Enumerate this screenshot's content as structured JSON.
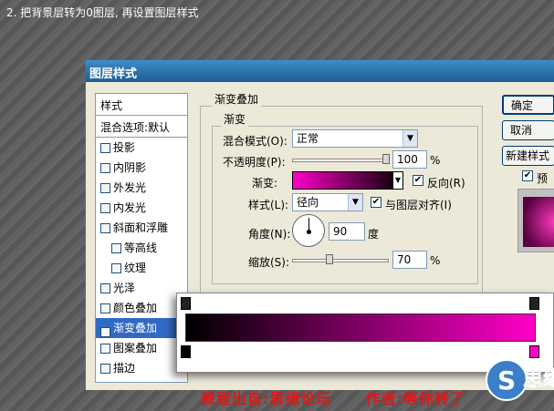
{
  "caption": "2. 把背景层转为0图层, 再设置图层样式",
  "dialog": {
    "title": "图层样式",
    "left_panel": {
      "header": "样式",
      "blend_default": "混合选项:默认",
      "items": [
        {
          "label": "投影",
          "checked": false
        },
        {
          "label": "内阴影",
          "checked": false
        },
        {
          "label": "外发光",
          "checked": false
        },
        {
          "label": "内发光",
          "checked": false
        },
        {
          "label": "斜面和浮雕",
          "checked": false
        },
        {
          "label": "等高线",
          "checked": false
        },
        {
          "label": "纹理",
          "checked": false
        },
        {
          "label": "光泽",
          "checked": false
        },
        {
          "label": "颜色叠加",
          "checked": false
        },
        {
          "label": "渐变叠加",
          "checked": true
        },
        {
          "label": "图案叠加",
          "checked": false
        },
        {
          "label": "描边",
          "checked": false
        }
      ]
    },
    "gradient_overlay": {
      "group_title": "渐变叠加",
      "sub_title": "渐变",
      "blend_mode_label": "混合模式(O):",
      "blend_mode_value": "正常",
      "opacity_label": "不透明度(P):",
      "opacity_value": "100",
      "opacity_unit": "%",
      "gradient_label": "渐变:",
      "reverse_label": "反向(R)",
      "reverse_checked": true,
      "style_label": "样式(L):",
      "style_value": "径向",
      "align_label": "与图层对齐(I)",
      "align_checked": true,
      "angle_label": "角度(N):",
      "angle_value": "90",
      "angle_unit": "度",
      "scale_label": "缩放(S):",
      "scale_value": "70",
      "scale_unit": "%"
    },
    "buttons": {
      "ok": "确定",
      "cancel": "取消",
      "new_style": "新建样式",
      "preview": "预览"
    },
    "preview_checked": true
  },
  "gradient_colors": {
    "start": "#000000",
    "end": "#ff00c8"
  },
  "footer": {
    "source": "教程出自:思缘论坛",
    "author": "作者:等你转了"
  },
  "watermark_text": "S 思缘"
}
